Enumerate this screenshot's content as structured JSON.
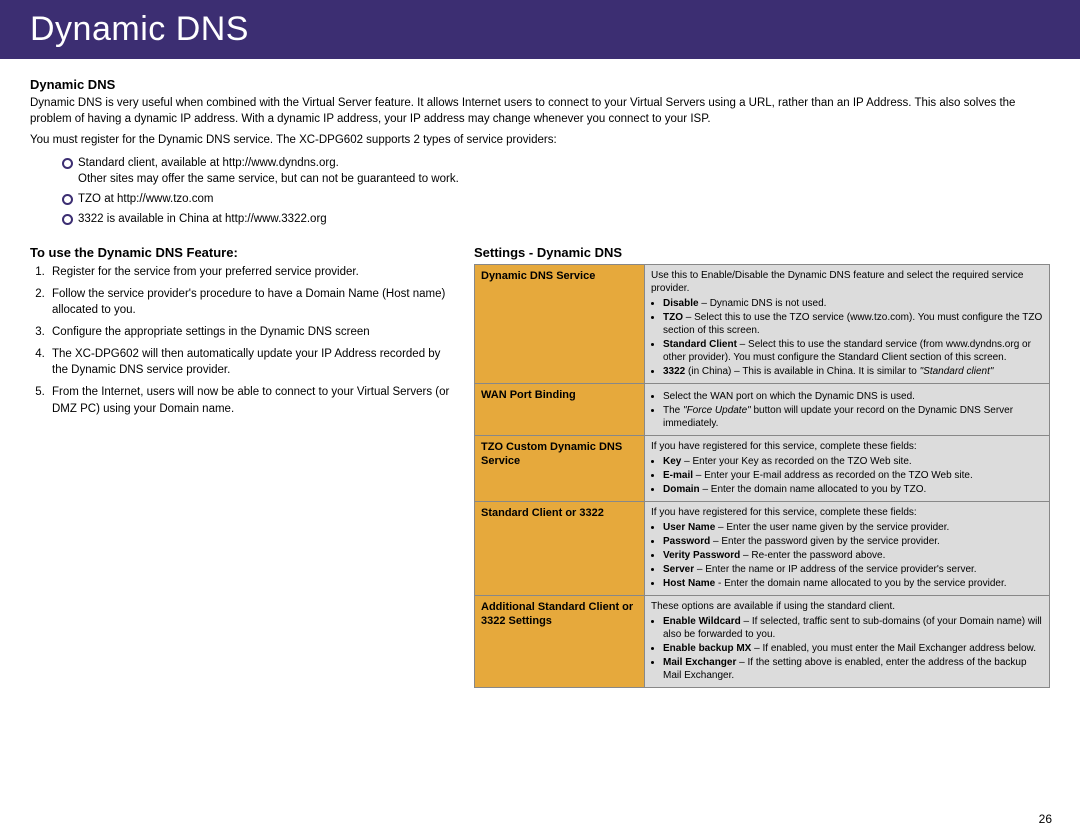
{
  "header": {
    "title": "Dynamic DNS"
  },
  "intro": {
    "heading": "Dynamic DNS",
    "p1": "Dynamic DNS is very useful when combined with the Virtual Server feature. It allows Internet users to connect to your Virtual Servers using a URL, rather than an IP Address. This also solves the problem of having a dynamic IP address. With a dynamic IP address, your IP address may change whenever you connect to your ISP.",
    "p2": "You must register for the Dynamic DNS service. The XC-DPG602 supports 2 types of service providers:",
    "bullets": {
      "b1a": "Standard client, available at http://www.dyndns.org.",
      "b1b": "Other sites may offer the same service, but can not be guaranteed to work.",
      "b2": "TZO at http://www.tzo.com",
      "b3": "3322 is available in China at http://www.3322.org"
    }
  },
  "use": {
    "heading": "To use the Dynamic DNS Feature:",
    "steps": {
      "s1": "Register for the service from your preferred service provider.",
      "s2": "Follow the service provider's procedure to have a Domain Name (Host name) allocated to you.",
      "s3": "Configure the appropriate settings in the Dynamic DNS screen",
      "s4": "The XC-DPG602 will then automatically update your IP Address recorded by the Dynamic DNS service provider.",
      "s5": "From the Internet, users will now be able to connect to your Virtual Servers (or DMZ PC) using your Domain name."
    }
  },
  "settings": {
    "heading": "Settings - Dynamic DNS",
    "rows": {
      "r1": {
        "label": "Dynamic DNS Service",
        "lead": "Use this to Enable/Disable the Dynamic DNS feature and select the required service provider.",
        "b_disable_lbl": "Disable",
        "b_disable_txt": " – Dynamic DNS is not used.",
        "b_tzo_lbl": "TZO",
        "b_tzo_txt": " – Select this to use the TZO service (www.tzo.com). You must configure the TZO section of this screen.",
        "b_std_lbl": "Standard Client",
        "b_std_txt": " – Select this to use the standard service (from www.dyndns.org or other provider). You must configure the Standard Client section of this screen.",
        "b_3322_lbl": "3322",
        "b_3322_txt": " (in China) – This is available in China. It is similar to ",
        "b_3322_ital": "\"Standard client\""
      },
      "r2": {
        "label": "WAN Port Binding",
        "b1": "Select the WAN port on which the Dynamic DNS is used.",
        "b2a": "The ",
        "b2_ital": "\"Force Update\"",
        "b2b": " button will update your record on the Dynamic DNS Server immediately."
      },
      "r3": {
        "label": "TZO Custom Dynamic DNS Service",
        "lead": "If you have registered for this service, complete these fields:",
        "b_key_lbl": "Key",
        "b_key_txt": " – Enter your Key as recorded on the TZO Web site.",
        "b_email_lbl": "E-mail",
        "b_email_txt": " – Enter your E-mail address as recorded on the TZO Web site.",
        "b_dom_lbl": "Domain",
        "b_dom_txt": " – Enter the domain name allocated to you by TZO."
      },
      "r4": {
        "label": "Standard Client or 3322",
        "lead": "If you have registered for this service, complete these fields:",
        "b_un_lbl": "User Name",
        "b_un_txt": " – Enter the user name given by the service provider.",
        "b_pw_lbl": "Password",
        "b_pw_txt": " – Enter the password given by the service provider.",
        "b_vp_lbl": "Verity Password",
        "b_vp_txt": " – Re-enter the password above.",
        "b_srv_lbl": "Server",
        "b_srv_txt": " – Enter the name or IP address of the service provider's server.",
        "b_hn_lbl": "Host Name",
        "b_hn_txt": " - Enter the domain name allocated to you by the service provider."
      },
      "r5": {
        "label": "Additional Standard Client or 3322 Settings",
        "lead": "These options are available if using the standard client.",
        "b_wc_lbl": "Enable Wildcard",
        "b_wc_txt": " – If selected, traffic sent to sub-domains (of your Domain name) will also be forwarded to you.",
        "b_mx_lbl": "Enable backup MX",
        "b_mx_txt": " – If enabled, you must enter the Mail Exchanger address below.",
        "b_me_lbl": "Mail Exchanger",
        "b_me_txt": " – If the setting above is enabled, enter the address of the backup Mail Exchanger."
      }
    }
  },
  "pageNumber": "26"
}
